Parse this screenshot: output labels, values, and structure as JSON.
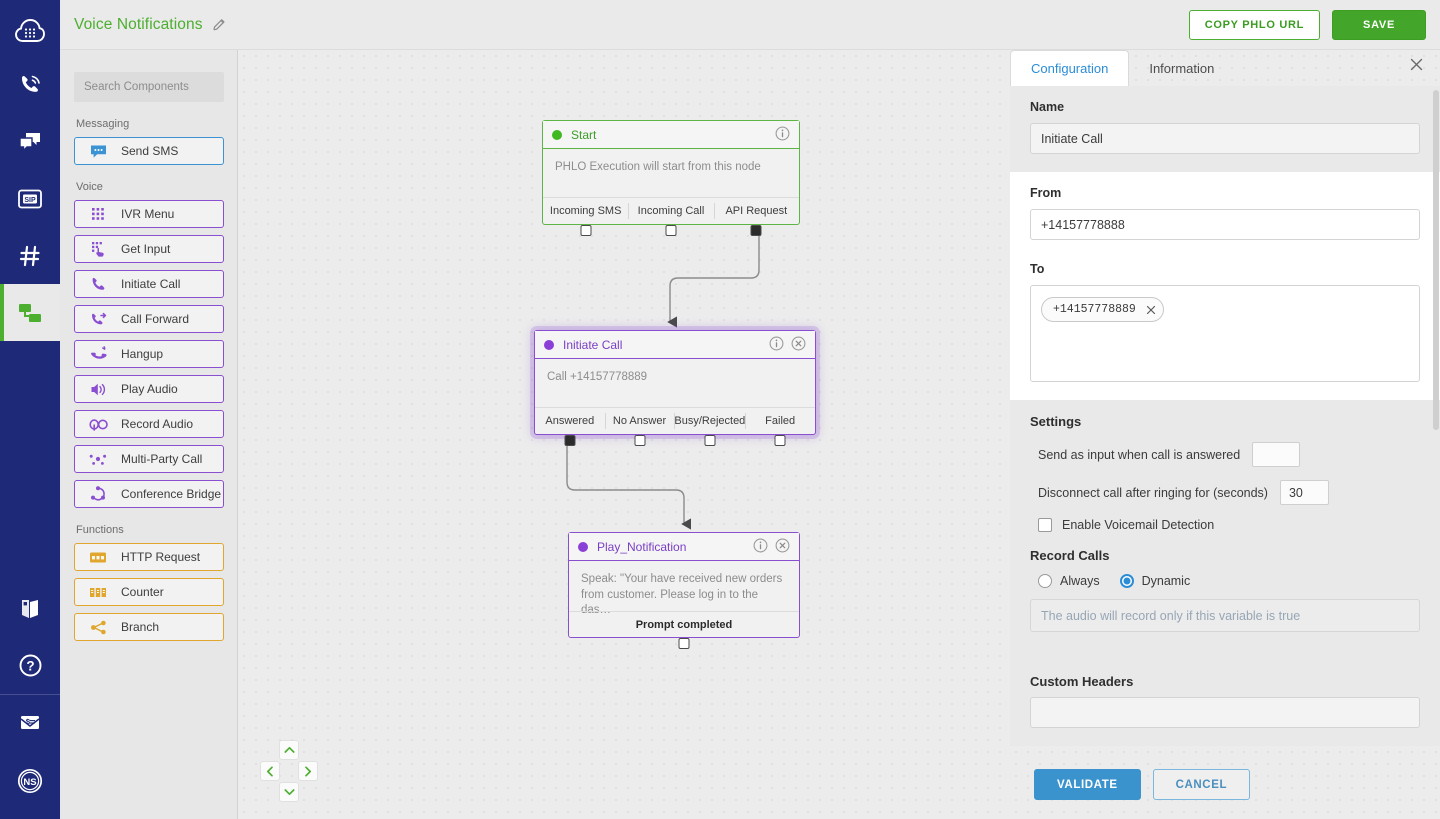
{
  "app": {
    "nav": {
      "logo_icon": "cloud-keypad-logo",
      "items": [
        {
          "icon": "phone-voice-icon",
          "name": "voice"
        },
        {
          "icon": "messages-icon",
          "name": "messaging"
        },
        {
          "icon": "sip-icon",
          "name": "sip"
        },
        {
          "icon": "hash-number-icon",
          "name": "numbers"
        },
        {
          "icon": "phlo-flow-icon",
          "name": "phlo",
          "active": true
        }
      ],
      "bottom_items": [
        {
          "icon": "book-docs-icon",
          "name": "docs"
        },
        {
          "icon": "help-question-icon",
          "name": "help"
        },
        {
          "icon": "billing-envelope-icon",
          "name": "billing"
        },
        {
          "icon": "avatar-icon",
          "name": "account",
          "initials": "NS"
        }
      ]
    }
  },
  "header": {
    "title": "Voice Notifications",
    "edit_icon": "pencil-icon",
    "copy_url_label": "COPY PHLO URL",
    "save_label": "SAVE"
  },
  "palette": {
    "search_placeholder": "Search Components",
    "groups": [
      {
        "label": "Messaging",
        "kind": "msg",
        "items": [
          {
            "label": "Send SMS",
            "icon": "chat-bubble-icon"
          }
        ]
      },
      {
        "label": "Voice",
        "kind": "voice",
        "items": [
          {
            "label": "IVR Menu",
            "icon": "keypad-icon"
          },
          {
            "label": "Get Input",
            "icon": "keypad-touch-icon"
          },
          {
            "label": "Initiate Call",
            "icon": "phone-handset-icon"
          },
          {
            "label": "Call Forward",
            "icon": "call-forward-icon"
          },
          {
            "label": "Hangup",
            "icon": "hangup-icon"
          },
          {
            "label": "Play Audio",
            "icon": "speaker-icon"
          },
          {
            "label": "Record Audio",
            "icon": "record-audio-icon"
          },
          {
            "label": "Multi-Party Call",
            "icon": "multi-party-icon"
          },
          {
            "label": "Conference Bridge",
            "icon": "conference-bridge-icon"
          }
        ]
      },
      {
        "label": "Functions",
        "kind": "func",
        "items": [
          {
            "label": "HTTP Request",
            "icon": "http-request-icon"
          },
          {
            "label": "Counter",
            "icon": "counter-icon"
          },
          {
            "label": "Branch",
            "icon": "branch-icon"
          }
        ]
      }
    ]
  },
  "canvas": {
    "nodes": {
      "start": {
        "title": "Start",
        "body": "PHLO Execution will start from this node",
        "info_icon": "info-icon",
        "ports": [
          {
            "label": "Incoming SMS",
            "connected": false
          },
          {
            "label": "Incoming Call",
            "connected": false
          },
          {
            "label": "API Request",
            "connected": true
          }
        ]
      },
      "initiate_call": {
        "title": "Initiate Call",
        "body": "Call +14157778889",
        "info_icon": "info-icon",
        "delete_icon": "delete-circle-icon",
        "ports": [
          {
            "label": "Answered",
            "connected": true
          },
          {
            "label": "No Answer",
            "connected": false
          },
          {
            "label": "Busy/Rejected",
            "connected": false
          },
          {
            "label": "Failed",
            "connected": false
          }
        ]
      },
      "play_notification": {
        "title": "Play_Notification",
        "body": "Speak: \"Your have received new orders from customer. Please log in to the das…",
        "info_icon": "info-icon",
        "delete_icon": "delete-circle-icon",
        "ports": [
          {
            "label": "Prompt completed",
            "connected": false
          }
        ]
      }
    },
    "pan_controls": {
      "up_icon": "chevron-up-icon",
      "down_icon": "chevron-down-icon",
      "left_icon": "chevron-left-icon",
      "right_icon": "chevron-right-icon"
    }
  },
  "panel": {
    "tabs": [
      {
        "label": "Configuration",
        "active": true
      },
      {
        "label": "Information",
        "active": false
      }
    ],
    "close_icon": "close-icon",
    "name_label": "Name",
    "name_value": "Initiate Call",
    "from_label": "From",
    "from_value": "+14157778888",
    "to_label": "To",
    "to_chips": [
      "+14157778889"
    ],
    "chip_remove_icon": "close-icon",
    "settings_title": "Settings",
    "send_input_label": "Send as input when call is answered",
    "send_input_value": "",
    "disconnect_label": "Disconnect call after ringing for (seconds)",
    "disconnect_value": "30",
    "voicemail_label": "Enable Voicemail Detection",
    "voicemail_checked": false,
    "record_calls_title": "Record Calls",
    "record_options": [
      {
        "label": "Always",
        "selected": false
      },
      {
        "label": "Dynamic",
        "selected": true
      }
    ],
    "record_variable_placeholder": "The audio will record only if this variable is true",
    "record_variable_value": "",
    "custom_headers_title": "Custom Headers",
    "validate_label": "VALIDATE",
    "cancel_label": "CANCEL"
  },
  "colors": {
    "brand_navy": "#1e2a78",
    "accent_green": "#4caf2f",
    "voice_purple": "#8a4fd1",
    "messaging_blue": "#3b93d4",
    "function_amber": "#e0a62e",
    "action_blue": "#3a93cc"
  }
}
